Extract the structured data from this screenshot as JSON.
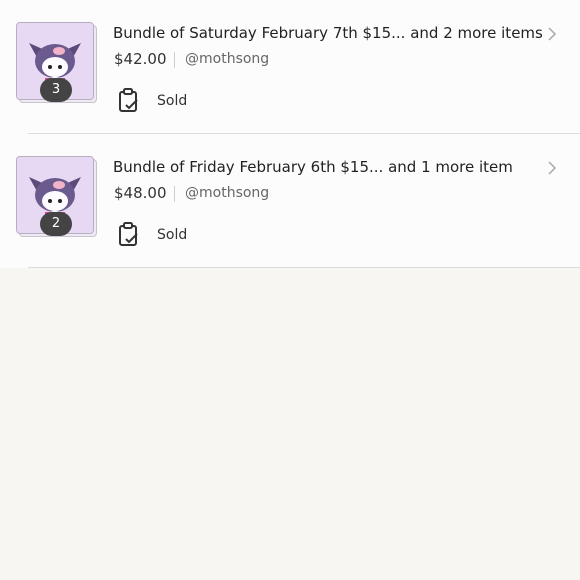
{
  "orders": [
    {
      "title": "Bundle of Saturday February 7th $15... and 2 more items",
      "price": "$42.00",
      "seller": "@mothsong",
      "status": "Sold",
      "item_count": "3",
      "status_icon": "clipboard-check-icon"
    },
    {
      "title": "Bundle of Friday February 6th $15... and 1 more item",
      "price": "$48.00",
      "seller": "@mothsong",
      "status": "Sold",
      "item_count": "2",
      "status_icon": "clipboard-check-icon"
    }
  ],
  "colors": {
    "page_background": "#f7f6f3",
    "row_background": "#fdfcfd",
    "badge": "#444444",
    "thumbnail_background": "#e7d8f3"
  }
}
